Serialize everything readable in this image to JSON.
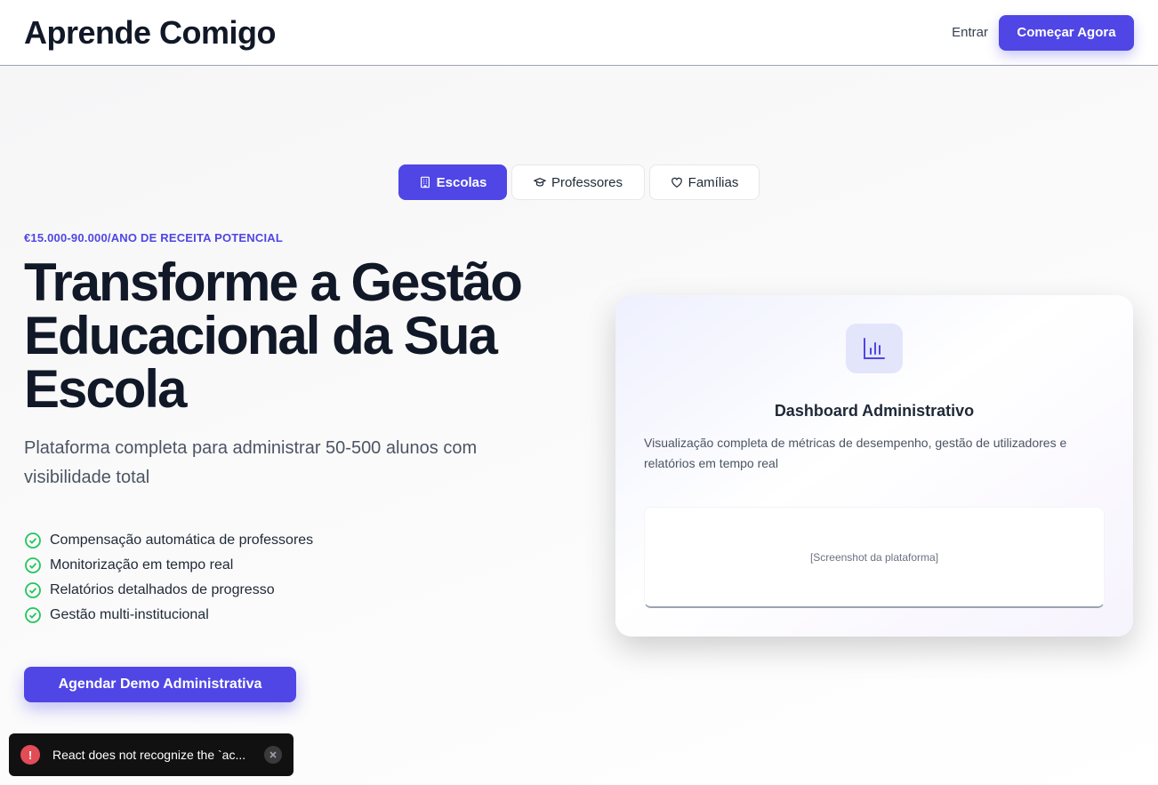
{
  "header": {
    "brand": "Aprende Comigo",
    "login_label": "Entrar",
    "cta_label": "Começar Agora"
  },
  "tabs": [
    {
      "label": "Escolas",
      "icon": "building-icon",
      "active": true
    },
    {
      "label": "Professores",
      "icon": "graduation-cap-icon",
      "active": false
    },
    {
      "label": "Famílias",
      "icon": "heart-icon",
      "active": false
    }
  ],
  "hero": {
    "eyebrow": "€15.000-90.000/ANO DE RECEITA POTENCIAL",
    "title": "Transforme a Gestão Educacional da Sua Escola",
    "subtitle": "Plataforma completa para administrar 50-500 alunos com visibilidade total",
    "features": [
      "Compensação automática de professores",
      "Monitorização em tempo real",
      "Relatórios detalhados de progresso",
      "Gestão multi-institucional"
    ],
    "cta_label": "Agendar Demo Administrativa"
  },
  "card": {
    "icon": "bar-chart-icon",
    "title": "Dashboard Administrativo",
    "description": "Visualização completa de métricas de desempenho, gestão de utilizadores e relatórios em tempo real",
    "screenshot_placeholder": "[Screenshot da plataforma]"
  },
  "toast": {
    "message": "React does not recognize the `ac..."
  },
  "colors": {
    "accent": "#4f46e5",
    "check": "#22c55e",
    "error": "#e24c57"
  }
}
